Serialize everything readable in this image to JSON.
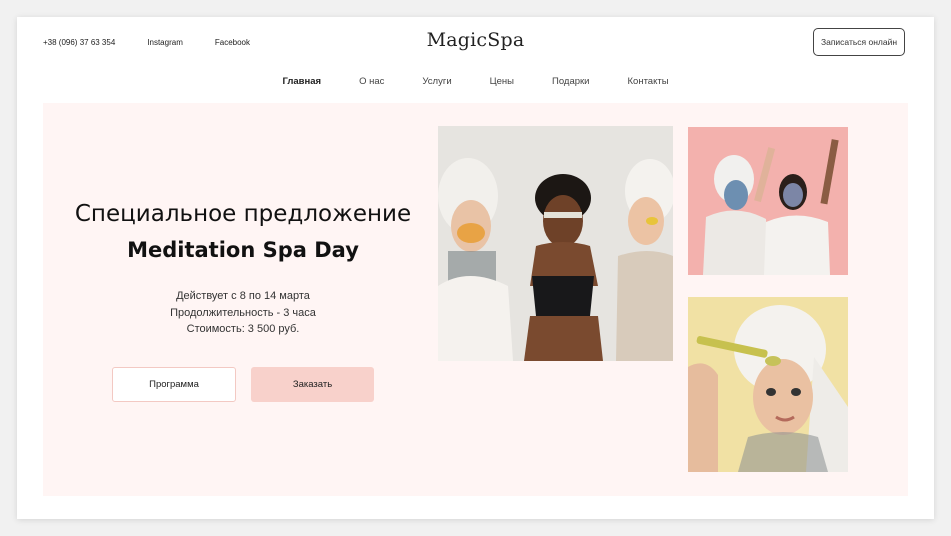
{
  "header": {
    "phone": "+38 (096) 37 63 354",
    "instagram": "Instagram",
    "facebook": "Facebook",
    "logo": "MagicSpa",
    "book_button": "Записаться онлайн"
  },
  "nav": {
    "items": [
      {
        "label": "Главная",
        "active": true
      },
      {
        "label": "О нас"
      },
      {
        "label": "Услуги"
      },
      {
        "label": "Цены"
      },
      {
        "label": "Подарки"
      },
      {
        "label": "Контакты"
      }
    ]
  },
  "hero": {
    "title": "Специальное предложение",
    "subtitle": "Meditation Spa Day",
    "details": [
      "Действует с 8 по 14 марта",
      "Продолжительность  - 3 часа",
      "Стоимость: 3 500 руб."
    ],
    "program_button": "Программа",
    "order_button": "Заказать"
  },
  "colors": {
    "hero_bg": "#fff5f4",
    "order_button_bg": "#f8d1cb",
    "program_button_border": "#f3c9c3"
  }
}
